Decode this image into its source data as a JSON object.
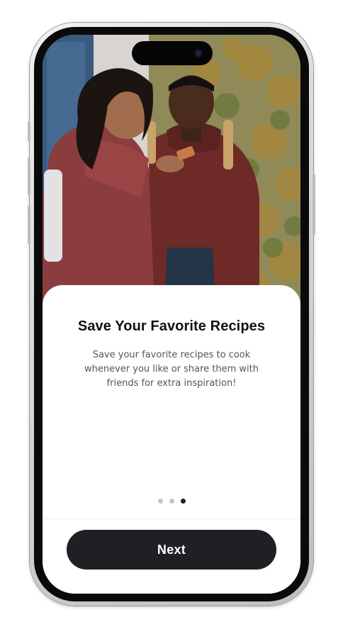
{
  "onboarding": {
    "title": "Save Your Favorite Recipes",
    "description": "Save your favorite recipes to cook whenever you like or share them with friends for extra inspiration!",
    "pager": {
      "total": 3,
      "current": 3
    },
    "next_label": "Next"
  },
  "colors": {
    "primary_button": "#1f1f24",
    "active_dot": "#1f1f24",
    "inactive_dot": "#c4c4c4",
    "title_text": "#111111",
    "body_text": "#555555"
  },
  "icons": {
    "camera": "front-camera-icon"
  }
}
